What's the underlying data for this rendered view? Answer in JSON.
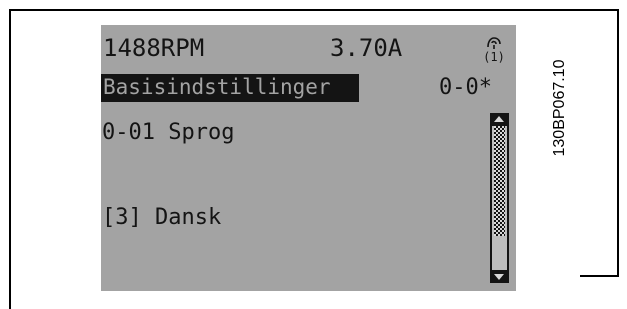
{
  "status_bar": {
    "speed": "1488RPM",
    "current": "3.70A",
    "mode_icon": "hand-on-icon",
    "mode_icon_label": "(1)"
  },
  "title_bar": {
    "menu_name": "Basisindstillinger",
    "menu_code": "0-0*"
  },
  "parameter": {
    "number_name": "0-01 Sprog",
    "value": "[3] Dansk"
  },
  "figure_code": "130BP067.10",
  "colors": {
    "lcd_background": "#a3a3a3",
    "lcd_foreground": "#141414"
  }
}
